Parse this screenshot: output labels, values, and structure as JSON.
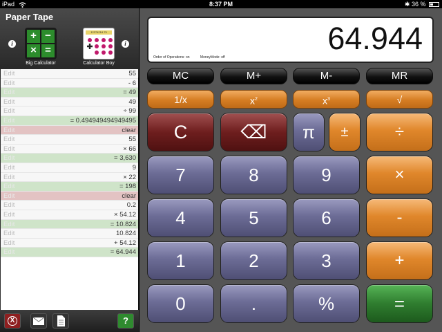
{
  "status_bar": {
    "device": "iPad",
    "time": "8:37 PM",
    "battery": "36 %",
    "battery_level": 0.36
  },
  "tape_panel": {
    "title": "Paper Tape",
    "apps": [
      {
        "label": "Big Calculator",
        "icon": "big-calculator-icon",
        "glyphs": [
          "+",
          "−",
          "×",
          "="
        ]
      },
      {
        "label": "Calculator Boy",
        "icon": "calculator-boy-icon",
        "screen_text": "12374218.75"
      }
    ],
    "rows": [
      {
        "edit": "Edit",
        "value": "55",
        "kind": "entry"
      },
      {
        "edit": "Edit",
        "value": "- 6",
        "kind": "entry"
      },
      {
        "edit": "Edit",
        "value": "= 49",
        "kind": "result"
      },
      {
        "edit": "Edit",
        "value": "49",
        "kind": "entry"
      },
      {
        "edit": "Edit",
        "value": "÷ 99",
        "kind": "entry"
      },
      {
        "edit": "Edit",
        "value": "= 0.494949494949495",
        "kind": "result"
      },
      {
        "edit": "Edit",
        "value": "clear",
        "kind": "clear"
      },
      {
        "edit": "Edit",
        "value": "55",
        "kind": "entry"
      },
      {
        "edit": "Edit",
        "value": "× 66",
        "kind": "entry"
      },
      {
        "edit": "Edit",
        "value": "= 3,630",
        "kind": "result"
      },
      {
        "edit": "Edit",
        "value": "9",
        "kind": "entry"
      },
      {
        "edit": "Edit",
        "value": "× 22",
        "kind": "entry"
      },
      {
        "edit": "Edit",
        "value": "= 198",
        "kind": "result"
      },
      {
        "edit": "Edit",
        "value": "clear",
        "kind": "clear"
      },
      {
        "edit": "Edit",
        "value": "0.2",
        "kind": "entry"
      },
      {
        "edit": "Edit",
        "value": "× 54.12",
        "kind": "entry"
      },
      {
        "edit": "Edit",
        "value": "= 10.824",
        "kind": "result"
      },
      {
        "edit": "Edit",
        "value": "10.824",
        "kind": "entry"
      },
      {
        "edit": "Edit",
        "value": "+ 54.12",
        "kind": "entry"
      },
      {
        "edit": "Edit",
        "value": "= 64.944",
        "kind": "result"
      }
    ],
    "toolbar": {
      "help_label": "?"
    }
  },
  "display": {
    "value": "64.944",
    "order_of_operations": "Order of Operations:  on",
    "money_mode": "MoneyMode:  off"
  },
  "memory_keys": [
    "MC",
    "M+",
    "M-",
    "MR"
  ],
  "function_keys": {
    "reciprocal": "1/x",
    "square": "x",
    "cube": "x",
    "sqrt": "√",
    "square_sup": "2",
    "cube_sup": "3"
  },
  "keys": {
    "clear": "C",
    "backspace": "⌫",
    "pi": "π",
    "plusminus": "±",
    "divide": "÷",
    "seven": "7",
    "eight": "8",
    "nine": "9",
    "multiply": "×",
    "four": "4",
    "five": "5",
    "six": "6",
    "minus": "-",
    "one": "1",
    "two": "2",
    "three": "3",
    "plus": "+",
    "zero": "0",
    "decimal": ".",
    "percent": "%",
    "equals": "="
  },
  "colors": {
    "accent_orange": "#e0872b",
    "key_blue": "#6c6c96",
    "clear_red": "#6e1e1e",
    "equals_green": "#2f7d2f",
    "result_row": "#cfe4c9",
    "clear_row": "#e3c3c3"
  }
}
